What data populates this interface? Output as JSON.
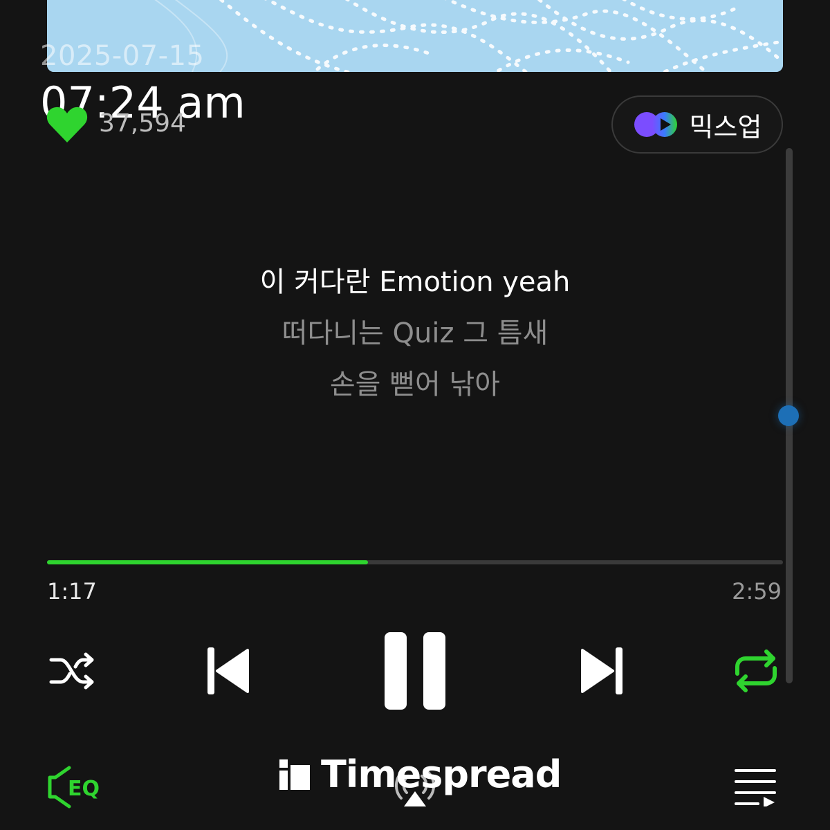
{
  "overlay": {
    "date": "2025-07-15",
    "time": "07:24 am"
  },
  "likes": {
    "count": "37,594",
    "color": "#2fd42f"
  },
  "mixup": {
    "label": "믹스업"
  },
  "lyrics": {
    "current": "이 커다란 Emotion yeah",
    "next_1": "떠다니는 Quiz 그 틈새",
    "next_2": "손을 뻗어 낚아"
  },
  "playback": {
    "elapsed": "1:17",
    "duration": "2:59",
    "progress_fraction": 0.436,
    "accent_color": "#2fd42f",
    "state": "playing"
  },
  "controls": {
    "shuffle_icon": "shuffle-icon",
    "prev_icon": "skip-previous-icon",
    "pause_icon": "pause-icon",
    "next_icon": "skip-next-icon",
    "repeat_icon": "repeat-icon",
    "eq_label": "EQ",
    "airplay_icon": "airplay-icon",
    "playlist_icon": "playlist-icon"
  },
  "watermark": {
    "text": "Timespread"
  }
}
